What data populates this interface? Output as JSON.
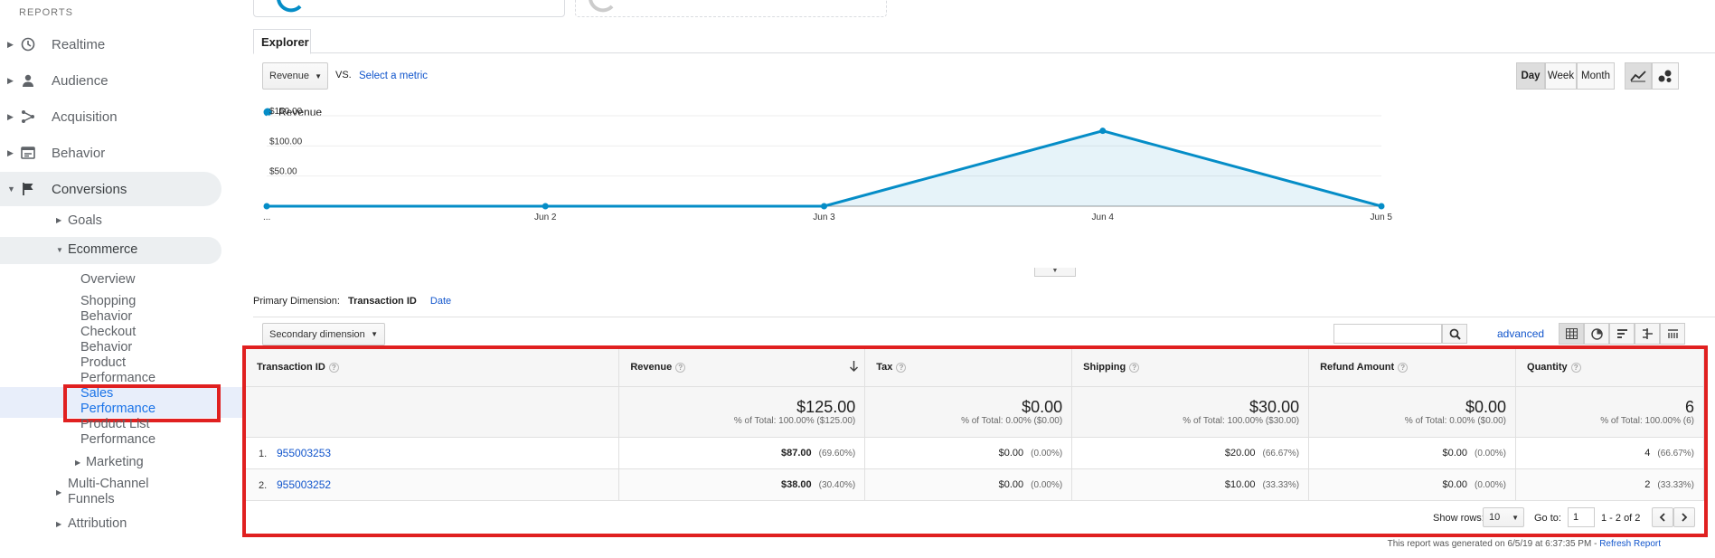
{
  "sidebar": {
    "section_label": "REPORTS",
    "items": [
      {
        "label": "Realtime",
        "icon": "clock-icon"
      },
      {
        "label": "Audience",
        "icon": "person-icon"
      },
      {
        "label": "Acquisition",
        "icon": "acquisition-icon"
      },
      {
        "label": "Behavior",
        "icon": "behavior-icon"
      },
      {
        "label": "Conversions",
        "icon": "flag-icon"
      }
    ],
    "sub": {
      "goals": "Goals",
      "ecommerce": "Ecommerce",
      "overview": "Overview",
      "shopping_1": "Shopping",
      "shopping_2": "Behavior",
      "checkout_1": "Checkout",
      "checkout_2": "Behavior",
      "product_1": "Product",
      "product_2": "Performance",
      "sales_1": "Sales",
      "sales_2": "Performance",
      "plist_1": "Product List",
      "plist_2": "Performance",
      "marketing": "Marketing",
      "mcf_1": "Multi-Channel",
      "mcf_2": "Funnels",
      "attribution": "Attribution"
    }
  },
  "explorer": {
    "tab": "Explorer",
    "metric_select": "Revenue",
    "vs": "VS.",
    "select_metric": "Select a metric",
    "periods": [
      "Day",
      "Week",
      "Month"
    ],
    "active_period": "Day"
  },
  "chart_data": {
    "type": "area",
    "series": [
      {
        "name": "Revenue",
        "values": [
          0,
          0,
          0,
          125,
          0
        ]
      }
    ],
    "x": [
      "...",
      "Jun 2",
      "Jun 3",
      "Jun 4",
      "Jun 5"
    ],
    "yticks": [
      "$150.00",
      "$100.00",
      "$50.00"
    ],
    "ylim": [
      0,
      150
    ],
    "color": "#058dc7"
  },
  "dimension": {
    "label": "Primary Dimension:",
    "active": "Transaction ID",
    "other": "Date",
    "secondary": "Secondary dimension",
    "advanced": "advanced"
  },
  "table": {
    "headers": [
      "Transaction ID",
      "Revenue",
      "Tax",
      "Shipping",
      "Refund Amount",
      "Quantity"
    ],
    "totals": [
      {
        "value": "$125.00",
        "pct": "% of Total: 100.00% ($125.00)"
      },
      {
        "value": "$0.00",
        "pct": "% of Total: 0.00% ($0.00)"
      },
      {
        "value": "$30.00",
        "pct": "% of Total: 100.00% ($30.00)"
      },
      {
        "value": "$0.00",
        "pct": "% of Total: 0.00% ($0.00)"
      },
      {
        "value": "6",
        "pct": "% of Total: 100.00% (6)"
      }
    ],
    "rows": [
      {
        "num": "1.",
        "id": "955003253",
        "revenue": "$87.00",
        "revenue_pct": "(69.60%)",
        "tax": "$0.00",
        "tax_pct": "(0.00%)",
        "shipping": "$20.00",
        "shipping_pct": "(66.67%)",
        "refund": "$0.00",
        "refund_pct": "(0.00%)",
        "qty": "4",
        "qty_pct": "(66.67%)"
      },
      {
        "num": "2.",
        "id": "955003252",
        "revenue": "$38.00",
        "revenue_pct": "(30.40%)",
        "tax": "$0.00",
        "tax_pct": "(0.00%)",
        "shipping": "$10.00",
        "shipping_pct": "(33.33%)",
        "refund": "$0.00",
        "refund_pct": "(0.00%)",
        "qty": "2",
        "qty_pct": "(33.33%)"
      }
    ]
  },
  "pager": {
    "show_rows": "Show rows:",
    "rows_value": "10",
    "goto": "Go to:",
    "goto_value": "1",
    "range": "1 - 2 of 2"
  },
  "footer": {
    "generated": "This report was generated on 6/5/19 at 6:37:35 PM -",
    "refresh": "Refresh Report"
  }
}
